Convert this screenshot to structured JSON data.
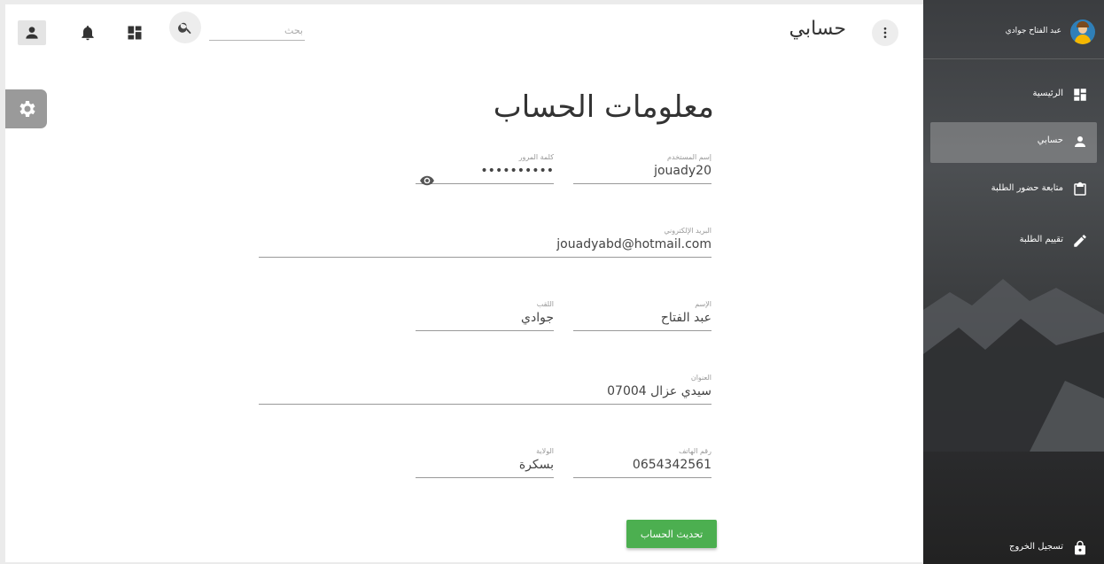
{
  "topbar": {
    "search_placeholder": "بحث",
    "page_heading": "حسابي"
  },
  "icons": {
    "user": "person-icon",
    "bell": "bell-icon",
    "dashboard": "dashboard-icon",
    "search": "search-icon",
    "more": "more-vert-icon",
    "settings": "gear-icon",
    "visibility": "eye-icon"
  },
  "form": {
    "title": "معلومات الحساب",
    "username": {
      "label": "إسم المستخدم",
      "value": "jouady20"
    },
    "password": {
      "label": "كلمة المرور",
      "value": "••••••••••"
    },
    "email": {
      "label": "البريد الإلكتروني",
      "value": "jouadyabd@hotmail.com"
    },
    "first_name": {
      "label": "الإسم",
      "value": "عبد الفتاح"
    },
    "last_name": {
      "label": "اللقب",
      "value": "جوادي"
    },
    "address": {
      "label": "العنوان",
      "value": "سيدي عزال 07004"
    },
    "phone": {
      "label": "رقم الهاتف",
      "value": "0654342561"
    },
    "state": {
      "label": "الولاية",
      "value": "بسكرة"
    },
    "submit_label": "تحديث الحساب"
  },
  "sidebar": {
    "user_name": "عبد الفتاح جوادي",
    "items": [
      {
        "label": "الرئيسية",
        "icon": "dashboard-icon",
        "active": false
      },
      {
        "label": "حسابي",
        "icon": "person-icon",
        "active": true
      },
      {
        "label": "متابعة حضور الطلبة",
        "icon": "clipboard-icon",
        "active": false
      },
      {
        "label": "تقييم الطلبة",
        "icon": "pencil-icon",
        "active": false
      }
    ],
    "logout_label": "تسجيل الخروج",
    "logout_icon": "lock-icon"
  },
  "colors": {
    "accent_button": "#4caf50",
    "sidebar_bg": "#3b3d40"
  }
}
